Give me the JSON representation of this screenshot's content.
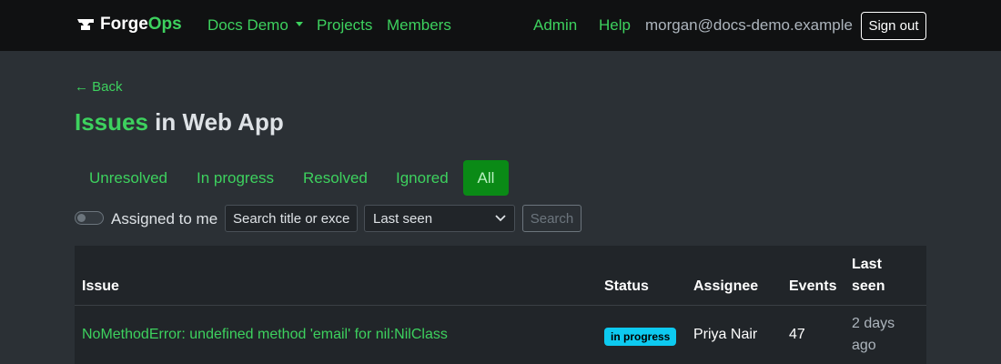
{
  "navbar": {
    "brand_part1": "Forge",
    "brand_part2": "Ops",
    "brand_icon": "anvil-icon",
    "org_menu": "Docs Demo",
    "projects": "Projects",
    "members": "Members",
    "admin": "Admin",
    "help": "Help",
    "user_email": "morgan@docs-demo.example",
    "sign_out": "Sign out"
  },
  "page": {
    "back": "← Back",
    "title_accent": "Issues",
    "title_rest": " in Web App"
  },
  "tabs": [
    {
      "label": "Unresolved",
      "active": false
    },
    {
      "label": "In progress",
      "active": false
    },
    {
      "label": "Resolved",
      "active": false
    },
    {
      "label": "Ignored",
      "active": false
    },
    {
      "label": "All",
      "active": true
    }
  ],
  "filters": {
    "assigned_to_me_label": "Assigned to me",
    "assigned_to_me_on": false,
    "search_placeholder": "Search title or exce",
    "sort_selected": "Last seen",
    "search_button": "Search"
  },
  "table": {
    "headers": {
      "issue": "Issue",
      "status": "Status",
      "assignee": "Assignee",
      "events": "Events",
      "last_seen_line1": "Last",
      "last_seen_line2": "seen"
    },
    "rows": [
      {
        "issue": "NoMethodError: undefined method 'email' for nil:NilClass",
        "status": "in progress",
        "assignee": "Priya Nair",
        "events": "47",
        "last_seen_line1": "2 days",
        "last_seen_line2": "ago"
      }
    ]
  },
  "colors": {
    "accent": "#3dd15e",
    "active_tab": "#0a8a16",
    "badge_in_progress": "#0dcaf0",
    "navbar_bg": "#101112",
    "page_bg": "#2b3035"
  }
}
